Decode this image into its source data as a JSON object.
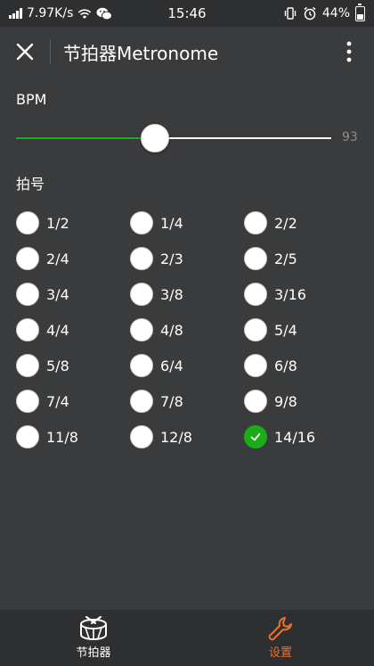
{
  "status_bar": {
    "net_speed": "7.97K/s",
    "time": "15:46",
    "battery": "44%"
  },
  "header": {
    "title": "节拍器Metronome"
  },
  "bpm": {
    "label": "BPM",
    "value": "93",
    "fill_fraction": 0.44
  },
  "time_signature": {
    "label": "拍号",
    "options": [
      {
        "label": "1/2",
        "checked": false
      },
      {
        "label": "1/4",
        "checked": false
      },
      {
        "label": "2/2",
        "checked": false
      },
      {
        "label": "2/4",
        "checked": false
      },
      {
        "label": "2/3",
        "checked": false
      },
      {
        "label": "2/5",
        "checked": false
      },
      {
        "label": "3/4",
        "checked": false
      },
      {
        "label": "3/8",
        "checked": false
      },
      {
        "label": "3/16",
        "checked": false
      },
      {
        "label": "4/4",
        "checked": false
      },
      {
        "label": "4/8",
        "checked": false
      },
      {
        "label": "5/4",
        "checked": false
      },
      {
        "label": "5/8",
        "checked": false
      },
      {
        "label": "6/4",
        "checked": false
      },
      {
        "label": "6/8",
        "checked": false
      },
      {
        "label": "7/4",
        "checked": false
      },
      {
        "label": "7/8",
        "checked": false
      },
      {
        "label": "9/8",
        "checked": false
      },
      {
        "label": "11/8",
        "checked": false
      },
      {
        "label": "12/8",
        "checked": false
      },
      {
        "label": "14/16",
        "checked": true
      }
    ]
  },
  "tabs": [
    {
      "label": "节拍器",
      "icon": "drum-icon",
      "active": false,
      "color": "#ffffff"
    },
    {
      "label": "设置",
      "icon": "wrench-icon",
      "active": true,
      "color": "#e8722d"
    }
  ],
  "colors": {
    "accent_green": "#1aad19",
    "active_tab_orange": "#e8722d",
    "background": "#3a3b3c"
  }
}
